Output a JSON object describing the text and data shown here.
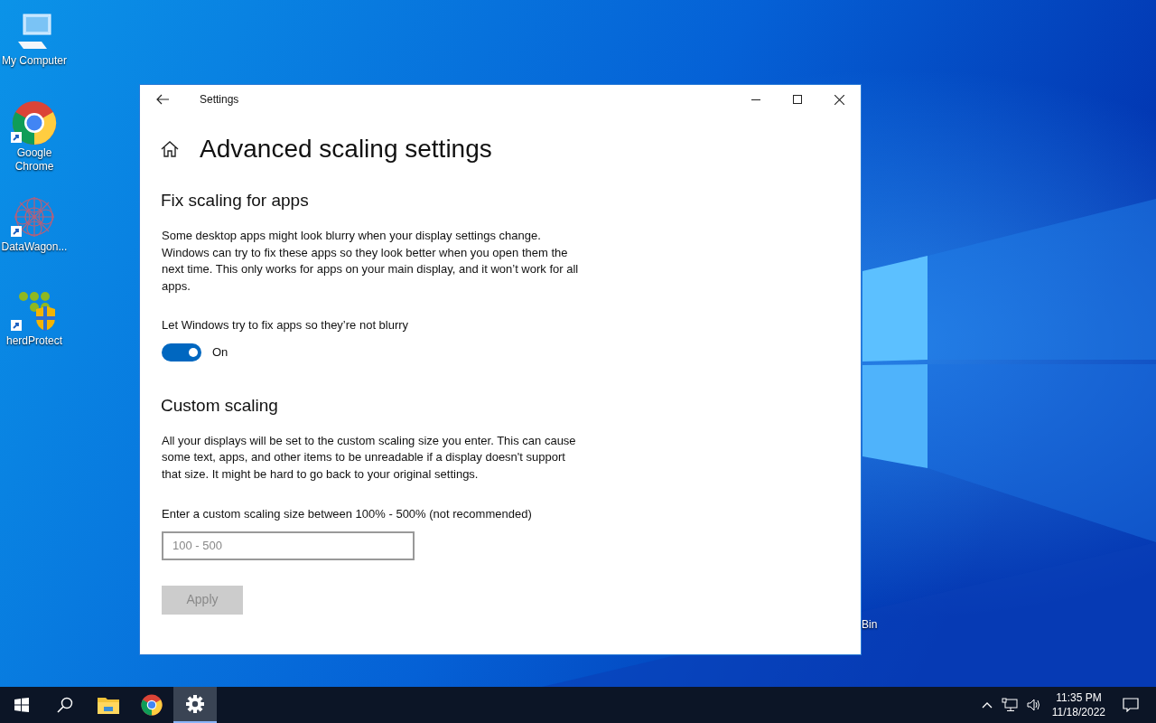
{
  "desktop_icons": [
    {
      "label": "My Computer",
      "kind": "computer",
      "shortcut": false
    },
    {
      "label": "Google Chrome",
      "kind": "chrome",
      "shortcut": true
    },
    {
      "label": "DataWagon...",
      "kind": "snowflake",
      "shortcut": true
    },
    {
      "label": "herdProtect",
      "kind": "shield",
      "shortcut": true
    }
  ],
  "partial_icon_label": "Bin",
  "window": {
    "title": "Settings",
    "page_title": "Advanced scaling settings",
    "fix_section": {
      "heading": "Fix scaling for apps",
      "description": "Some desktop apps might look blurry when your display settings change. Windows can try to fix these apps so they look better when you open them the next time. This only works for apps on your main display, and it won’t work for all apps.",
      "setting_label": "Let Windows try to fix apps so they’re not blurry",
      "toggle": {
        "on": true,
        "state_label": "On"
      }
    },
    "custom_section": {
      "heading": "Custom scaling",
      "description": "All your displays will be set to the custom scaling size you enter. This can cause some text, apps, and other items to be unreadable if a display doesn't support that size. It might be hard to go back to your original settings.",
      "field_label": "Enter a custom scaling size between 100% - 500% (not recommended)",
      "field": {
        "placeholder": "100 - 500"
      },
      "button": {
        "label": "Apply",
        "disabled": true
      }
    }
  },
  "taskbar": {
    "items": [
      {
        "kind": "start",
        "selected": false
      },
      {
        "kind": "search",
        "selected": false
      },
      {
        "kind": "explorer",
        "selected": false
      },
      {
        "kind": "chrome",
        "selected": false
      },
      {
        "kind": "settings",
        "selected": true
      }
    ],
    "clock": {
      "time": "11:35 PM",
      "date": "11/18/2022"
    }
  }
}
